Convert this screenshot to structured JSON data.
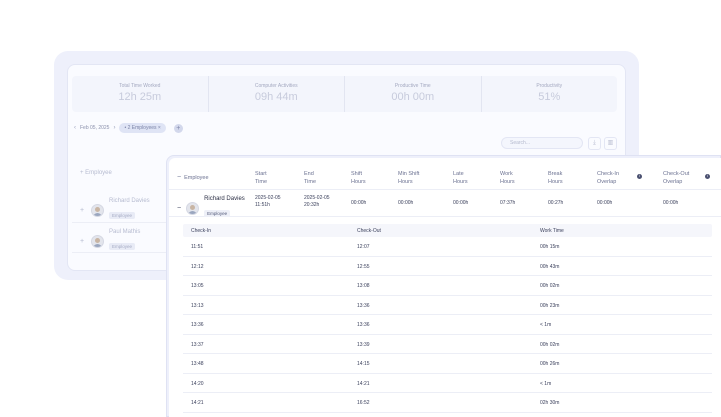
{
  "summary": {
    "stats": [
      {
        "label": "Total Time Worked",
        "value": "12h 25m"
      },
      {
        "label": "Computer Activities",
        "value": "09h 44m"
      },
      {
        "label": "Productive Time",
        "value": "00h 00m"
      },
      {
        "label": "Productivity",
        "value": "51%"
      }
    ]
  },
  "filters": {
    "date": "Feb 05, 2025",
    "employees_chip": "2 Employees",
    "search_placeholder": "Search..."
  },
  "back_table": {
    "employee_header": "Employee",
    "rows": [
      {
        "name": "Richard Davies",
        "role": "Employee"
      },
      {
        "name": "Paul Mathis",
        "role": "Employee"
      }
    ]
  },
  "table": {
    "headers": {
      "employee": "Employee",
      "start_time": [
        "Start",
        "Time"
      ],
      "end_time": [
        "End",
        "Time"
      ],
      "shift_hours": [
        "Shift",
        "Hours"
      ],
      "min_shift_hours": [
        "Min Shift",
        "Hours"
      ],
      "late_hours": [
        "Late",
        "Hours"
      ],
      "work_hours": [
        "Work",
        "Hours"
      ],
      "break_hours": [
        "Break",
        "Hours"
      ],
      "checkin_overlap": [
        "Check-In",
        "Overlap"
      ],
      "checkout_overlap": [
        "Check-Out",
        "Overlap"
      ]
    },
    "employee_row": {
      "name": "Richard Davies",
      "role": "Employee",
      "start_date": "2025-02-05",
      "start_time": "11:51h",
      "end_date": "2025-02-05",
      "end_time": "20:32h",
      "shift_hours": "00:00h",
      "min_shift_hours": "00:00h",
      "late_hours": "00:00h",
      "work_hours": "07:37h",
      "break_hours": "00:27h",
      "checkin_overlap": "00:00h",
      "checkout_overlap": "00:00h"
    },
    "detail": {
      "headers": {
        "check_in": "Check-In",
        "check_out": "Check-Out",
        "work_time": "Work Time"
      },
      "rows": [
        {
          "in": "11:51",
          "out": "12:07",
          "work": "00h 15m"
        },
        {
          "in": "12:12",
          "out": "12:55",
          "work": "00h 43m"
        },
        {
          "in": "13:05",
          "out": "13:08",
          "work": "00h 02m"
        },
        {
          "in": "13:13",
          "out": "13:36",
          "work": "00h 23m"
        },
        {
          "in": "13:36",
          "out": "13:36",
          "work": "< 1m"
        },
        {
          "in": "13:37",
          "out": "13:39",
          "work": "00h 02m"
        },
        {
          "in": "13:48",
          "out": "14:15",
          "work": "00h 26m"
        },
        {
          "in": "14:20",
          "out": "14:21",
          "work": "< 1m"
        },
        {
          "in": "14:21",
          "out": "16:52",
          "work": "02h 30m"
        }
      ]
    }
  }
}
